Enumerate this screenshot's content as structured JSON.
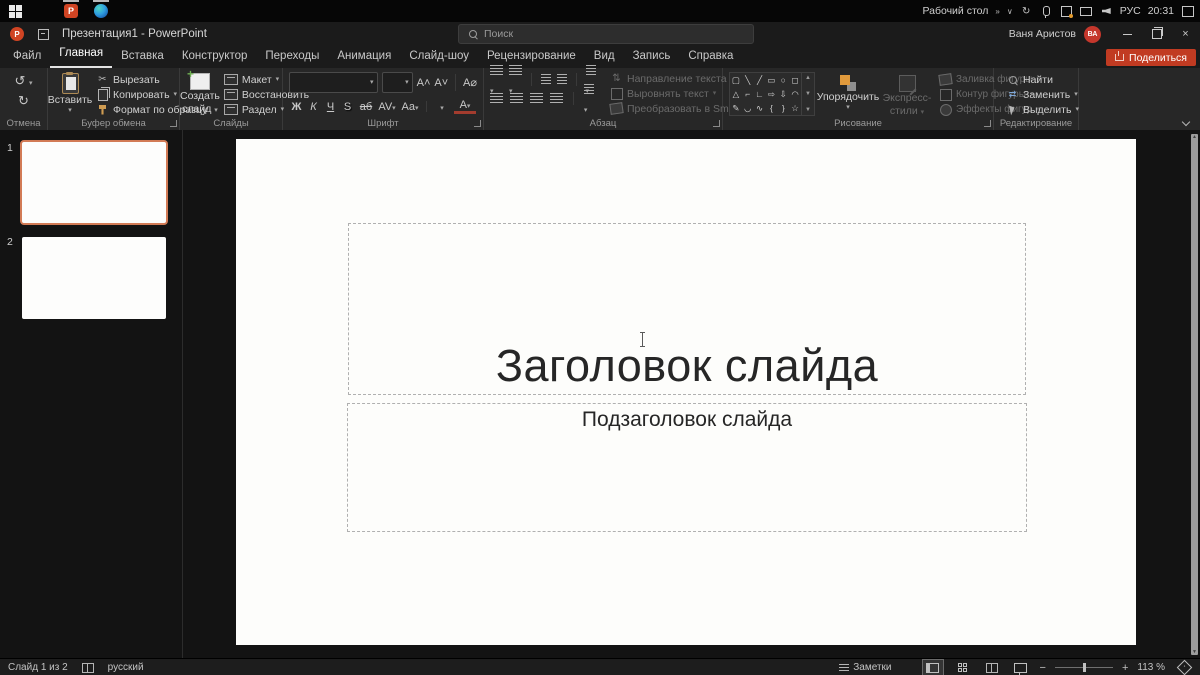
{
  "taskbar": {
    "desktop": "Рабочий стол",
    "chevrons": "»",
    "lang": "РУС",
    "time": "20:31"
  },
  "titlebar": {
    "title": "Презентация1 - PowerPoint",
    "search": "Поиск",
    "user": "Ваня Аристов",
    "initials": "ВА"
  },
  "tabs": [
    "Файл",
    "Главная",
    "Вставка",
    "Конструктор",
    "Переходы",
    "Анимация",
    "Слайд-шоу",
    "Рецензирование",
    "Вид",
    "Запись",
    "Справка"
  ],
  "share": "Поделиться",
  "ribbon": {
    "undo_label": "Отмена",
    "clipboard": {
      "label": "Буфер обмена",
      "paste": "Вставить",
      "cut": "Вырезать",
      "copy": "Копировать",
      "painter": "Формат по образцу"
    },
    "slides": {
      "label": "Слайды",
      "new_slide_1": "Создать",
      "new_slide_2": "слайд",
      "layout": "Макет",
      "reset": "Восстановить",
      "section": "Раздел"
    },
    "font": {
      "label": "Шрифт",
      "grow": "А",
      "shrink": "А",
      "clear": "А",
      "bold": "Ж",
      "italic": "К",
      "underline": "Ч",
      "shadow": "S",
      "strike": "аб",
      "spacing": "AV",
      "case": "Aa",
      "color": "А"
    },
    "paragraph": {
      "label": "Абзац",
      "direction": "Направление текста",
      "align_text": "Выровнять текст",
      "smartart": "Преобразовать в SmartArt"
    },
    "drawing": {
      "label": "Рисование",
      "arrange": "Упорядочить",
      "styles_1": "Экспресс-",
      "styles_2": "стили",
      "fill": "Заливка фигуры",
      "outline": "Контур фигуры",
      "effects": "Эффекты фигур",
      "shapes": [
        "▢",
        "╲",
        "╱",
        "▭",
        "○",
        "◻",
        "△",
        "⌐",
        "∟",
        "⇨",
        "⇩",
        "◠",
        "✎",
        "◡",
        "∿",
        "{",
        "}",
        "☆"
      ]
    },
    "editing": {
      "label": "Редактирование",
      "find": "Найти",
      "replace": "Заменить",
      "select": "Выделить"
    }
  },
  "slides_panel": [
    {
      "n": "1"
    },
    {
      "n": "2"
    }
  ],
  "slide": {
    "title": "Заголовок слайда",
    "subtitle": "Подзаголовок слайда"
  },
  "statusbar": {
    "counter": "Слайд 1 из 2",
    "lang": "русский",
    "notes": "Заметки",
    "zoom": "113 %"
  }
}
